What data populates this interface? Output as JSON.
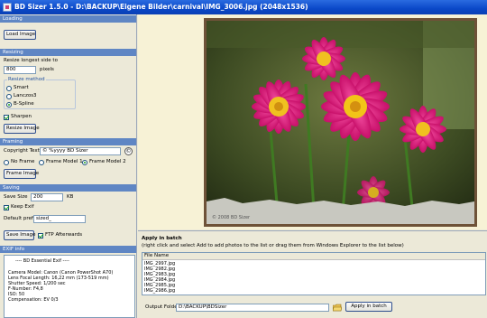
{
  "window": {
    "title": "BD Sizer 1.5.0 - D:\\BACKUP\\Eigene Bilder\\carnival\\IMG_3006.jpg (2048x1536)"
  },
  "loading": {
    "header": "Loading",
    "load_button": "Load Image"
  },
  "resizing": {
    "header": "Resizing",
    "longest_side_label": "Resize longest side to",
    "size_value": "800",
    "size_unit": "pixels",
    "method_label": "Resize method",
    "methods": [
      {
        "label": "Smart",
        "selected": false
      },
      {
        "label": "Lanczos3",
        "selected": false
      },
      {
        "label": "B-Spline",
        "selected": true
      }
    ],
    "sharpen_label": "Sharpen",
    "sharpen_checked": true,
    "resize_button": "Resize Image"
  },
  "framing": {
    "header": "Framing",
    "copyright_label": "Copyright Text",
    "copyright_value": "© %yyyy BD Sizer",
    "frames": [
      {
        "label": "No Frame",
        "selected": false
      },
      {
        "label": "Frame Model 1",
        "selected": false
      },
      {
        "label": "Frame Model 2",
        "selected": true
      }
    ],
    "frame_button": "Frame Image"
  },
  "saving": {
    "header": "Saving",
    "save_size_label": "Save Size",
    "save_size_value": "200",
    "save_size_unit": "KB",
    "keep_exif_label": "Keep Exif",
    "keep_exif_checked": true,
    "prefix_label": "Default prefix",
    "prefix_value": "sized_",
    "save_button": "Save Image",
    "ftp_label": "FTP Afterwards",
    "ftp_checked": true
  },
  "exif": {
    "header": "EXIF info",
    "lines": [
      "---- BD Essential Exif ----",
      "Camera Model: Canon (Canon PowerShot A70)",
      "Lens Focal Length: 16,22 mm (173-519 mm)",
      "Shutter Speed: 1/200 sec",
      "F-Number: F4,8",
      "ISO: 50",
      "Compensation: EV 0/3"
    ]
  },
  "preview": {
    "watermark": "© 2008 BD Sizer"
  },
  "batch": {
    "header": "Apply in batch",
    "hint": "(right click and select Add to add photos to the list or drag them from Windows Explorer to the list below)",
    "column_header": "File Name",
    "files": [
      "IMG_2997.jpg",
      "IMG_2982.jpg",
      "IMG_2983.jpg",
      "IMG_2984.jpg",
      "IMG_2985.jpg",
      "IMG_2986.jpg"
    ],
    "output_label": "Output Folder",
    "output_value": "D:\\BACKUP\\BDSizer",
    "apply_button": "Apply in batch"
  },
  "colors": {
    "section_header": "#5f86c4",
    "titlebar": "#0a48c8",
    "preview_bg": "#f7f2d6"
  },
  "icons": {
    "browse_folder": "folder-icon",
    "copyright_symbol": "copyright-icon"
  }
}
